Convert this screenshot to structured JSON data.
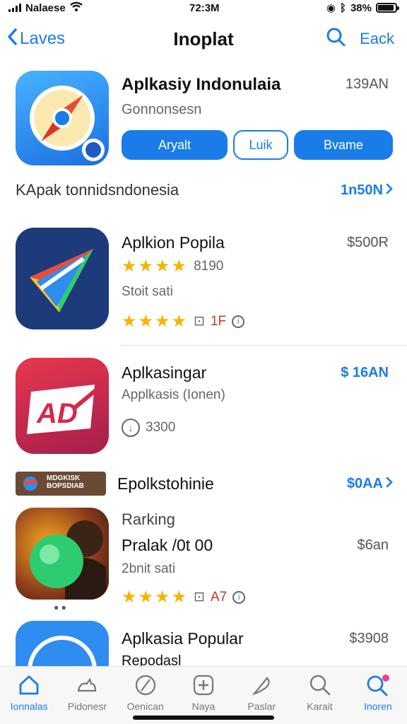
{
  "status": {
    "carrier": "Nalaese",
    "time": "72:3M",
    "battery": "38%",
    "battery_level": 0.9
  },
  "nav": {
    "back_label": "Laves",
    "title": "Inoplat",
    "right_label": "Eack"
  },
  "featured": {
    "title": "Aplkasiy Indonulaia",
    "subtitle": "Gonnonsesn",
    "time": "139AN",
    "buttons": [
      "Aryalt",
      "Luik",
      "Bvame"
    ]
  },
  "section1": {
    "title": "KApak tonnidsndonesia",
    "link": "1n50N"
  },
  "apps": [
    {
      "name": "Aplkion Popila",
      "price": "$500R",
      "stars_1": "★★★★",
      "rating_1": "8190",
      "meta": "Stoit sati",
      "stars_2": "★★★★",
      "rating_2": "1F"
    },
    {
      "name": "Aplkasingar",
      "price": "$ 16AN",
      "subtitle": "Applkasis (Ionen)",
      "rating": "3300"
    },
    {
      "name": "Rarking",
      "subtitle": "Pralak /0t 00",
      "price": "$6an",
      "meta": "2bnit sati",
      "stars": "★★★★",
      "rating": "A7"
    },
    {
      "name": "Aplkasia Popular",
      "subtitle": "Repodasl",
      "price": "$3908"
    }
  ],
  "section2": {
    "badge": "MDGKISK BOPSDIAB",
    "title": "Epolkstohinie",
    "link": "$0AA"
  },
  "tabs": [
    {
      "label": "Ionnalas",
      "icon": "home-icon",
      "active": true
    },
    {
      "label": "Pidonesr",
      "icon": "cat-icon",
      "active": false
    },
    {
      "label": "Oenican",
      "icon": "compass-icon",
      "active": false
    },
    {
      "label": "Naya",
      "icon": "plus-icon",
      "active": false
    },
    {
      "label": "Paslar",
      "icon": "feather-icon",
      "active": false
    },
    {
      "label": "Karait",
      "icon": "search-icon",
      "active": false
    },
    {
      "label": "Inoren",
      "icon": "search-badge-icon",
      "active": true
    }
  ],
  "colors": {
    "accent": "#1a7ce8",
    "star": "#f5b400"
  }
}
